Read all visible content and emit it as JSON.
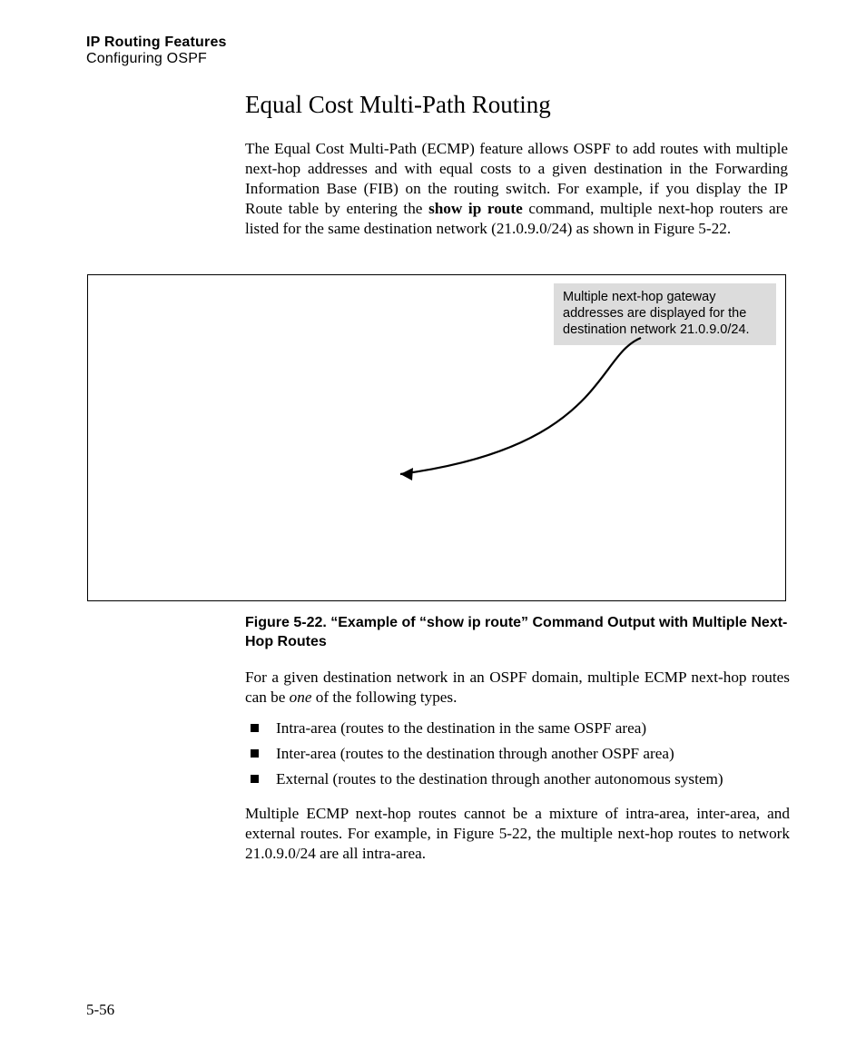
{
  "header": {
    "title": "IP Routing Features",
    "subtitle": "Configuring OSPF"
  },
  "section": {
    "title": "Equal Cost Multi-Path Routing",
    "intro_pre": "The Equal Cost Multi-Path (ECMP) feature allows OSPF to add routes with multiple next-hop addresses and with equal costs to a given destination in the Forwarding Information Base (FIB) on the routing switch. For example, if you display the IP Route table by entering the ",
    "intro_cmd": "show ip route",
    "intro_post": " command, multiple next-hop routers are listed for the same destination network (21.0.9.0/24) as shown in Figure 5-22."
  },
  "figure": {
    "callout": "Multiple next-hop gateway addresses are displayed for the destination network 21.0.9.0/24.",
    "caption": "Figure 5-22.  “Example of “show ip route” Command Output with Multiple Next-Hop Routes"
  },
  "after": {
    "p1_pre": "For a given destination network in an OSPF domain, multiple ECMP next-hop routes can be ",
    "p1_em": "one",
    "p1_post": " of the following types.",
    "bullets": [
      "Intra-area (routes to the destination in the same OSPF area)",
      "Inter-area (routes to the destination through another OSPF area)",
      "External (routes to the destination through another autonomous system)"
    ],
    "p2": "Multiple ECMP next-hop routes cannot be a mixture of intra-area, inter-area, and external routes. For example, in Figure 5-22, the multiple next-hop routes to network 21.0.9.0/24 are all intra-area."
  },
  "page_number": "5-56"
}
